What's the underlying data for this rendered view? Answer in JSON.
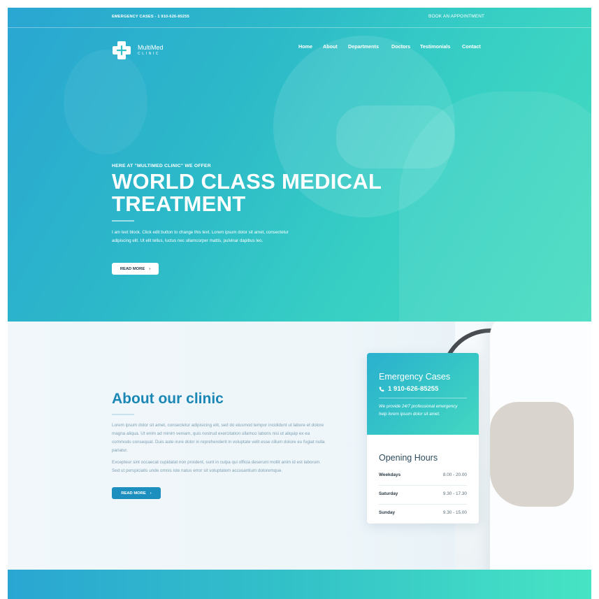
{
  "topbar": {
    "emergency": "EMERGENCY CASES - 1 910-626-85255",
    "book": "BOOK AN APPOINTMENT"
  },
  "logo": {
    "name": "MultiMed",
    "sub": "CLINIC"
  },
  "nav": [
    "Home",
    "About",
    "Departments",
    "Doctors",
    "Testimonials",
    "Contact"
  ],
  "hero": {
    "eyebrow": "HERE AT \"MULTIMED CLINIC\" WE OFFER",
    "title": "WORLD CLASS MEDICAL TREATMENT",
    "text": "I am text block. Click edit button to change this text. Lorem ipsum dolor sit amet, consectetur adipiscing elit. Ut elit tellus, luctus nec ullamcorper mattis, pulvinar dapibus leo.",
    "button": "READ MORE"
  },
  "about": {
    "title": "About our clinic",
    "p1": "Lorem ipsum dolor sit amet, consectetur adipisicing elit, sed do eiusmod tempor incididunt ut labore et dolore magna aliqua. Ut enim ad minim veniam, quis nostrud exercitation ullamco laboris nisi ut aliquip ex ea commodo consequat. Duis aute irure dolor in reprehenderit in voluptate velit esse cillum dolore eu fugiat nulla pariatur.",
    "p2": "Excepteur sint occaecat cupidatat non proident, sunt in culpa qui officia deserunt mollit anim id est laborum. Sed ut perspiciatis unde omnis iste natus error sit voluptatem accusantium doloremque.",
    "button": "READ MORE"
  },
  "card": {
    "emergency_title": "Emergency Cases",
    "phone": "1 910-626-85255",
    "note": "We provide 24/7 professional emergency help lorem ipsum dolor sit amet.",
    "hours_title": "Opening Hours",
    "hours": [
      {
        "day": "Weekdays",
        "time": "8.00 - 20.00"
      },
      {
        "day": "Saturday",
        "time": "9.30 - 17.30"
      },
      {
        "day": "Sunday",
        "time": "9.30 - 15.00"
      }
    ]
  },
  "colors": {
    "accent": "#1d8fbe",
    "hero_start": "#2aa6d2",
    "hero_end": "#46dcc0"
  }
}
